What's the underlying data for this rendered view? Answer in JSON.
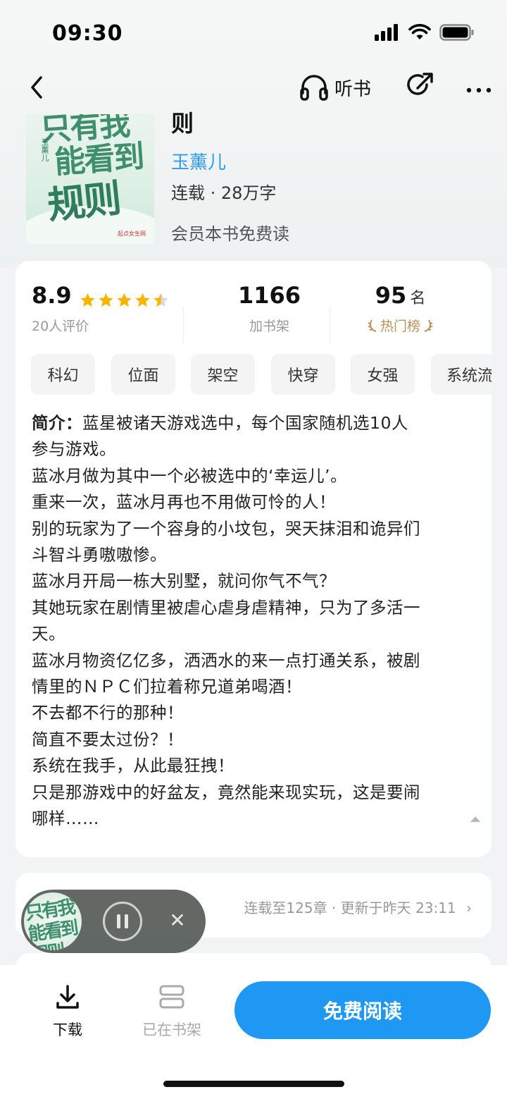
{
  "status_bar": {
    "time": "09:30"
  },
  "nav": {
    "listen_label": "听书"
  },
  "book": {
    "cover_title_lines": [
      "只有我",
      "能看到",
      "规则"
    ],
    "cover_author": "玉薰儿",
    "cover_publisher": "起点女生网",
    "title_fragment": "则",
    "author": "玉薰儿",
    "meta": "连载 · 28万字",
    "vip_note": "会员本书免费读"
  },
  "stats": {
    "rating": "8.9",
    "rating_count": "20人评价",
    "rating_stars": 4.5,
    "shelf_count": "1166",
    "shelf_label": "加书架",
    "rank": "95",
    "rank_unit": "名",
    "rank_label": "热门榜"
  },
  "tags": [
    "科幻",
    "位面",
    "架空",
    "快穿",
    "女强",
    "系统流"
  ],
  "intro": {
    "label": "简介",
    "colon": "：",
    "lines": [
      "蓝星被诸天游戏选中，每个国家随机选10人",
      "参与游戏。",
      "蓝冰月做为其中一个必被选中的‘幸运儿’。",
      "重来一次，蓝冰月再也不用做可怜的人！",
      "别的玩家为了一个容身的小坟包，哭天抹泪和诡异们",
      "斗智斗勇嗷嗷惨。",
      "蓝冰月开局一栋大别墅，就问你气不气？",
      "其她玩家在剧情里被虐心虐身虐精神，只为了多活一",
      "天。",
      "蓝冰月物资亿亿多，洒洒水的来一点打通关系，被剧",
      "情里的ＮＰＣ们拉着称兄道弟喝酒！",
      "不去都不行的那种！",
      "简直不要太过份？！",
      "系统在我手，从此最狂拽！",
      "只是那游戏中的好盆友，竟然能来现实玩，这是要闹",
      "哪样……"
    ]
  },
  "chapter_update": "连载至125章 · 更新于昨天 23:11",
  "player": {
    "disc_text": "只有我能看到规则",
    "close_symbol": "✕"
  },
  "bottom_bar": {
    "download_label": "下载",
    "shelf_label": "已在书架",
    "read_button": "免费阅读"
  },
  "colors": {
    "accent": "#1e98f2",
    "link": "#2e9cf0",
    "star": "#f7b500",
    "rank_gold": "#b8935a"
  }
}
